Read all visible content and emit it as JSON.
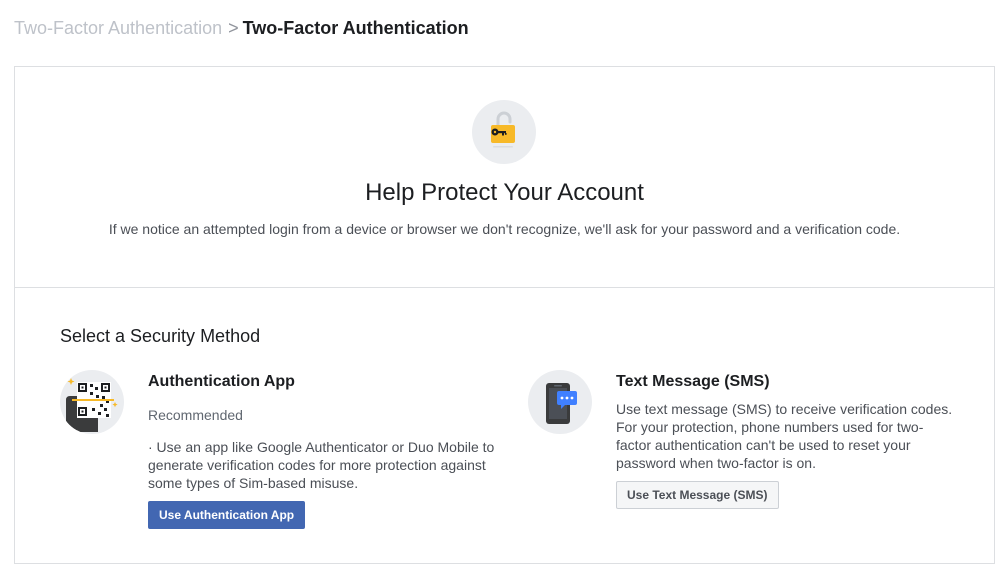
{
  "breadcrumb": {
    "parent": "Two-Factor Authentication",
    "separator": ">",
    "current": "Two-Factor Authentication"
  },
  "hero": {
    "icon": "unlocked-padlock-key-icon",
    "title": "Help Protect Your Account",
    "description": "If we notice an attempted login from a device or browser we don't recognize, we'll ask for your password and a verification code."
  },
  "section": {
    "title": "Select a Security Method"
  },
  "methods": {
    "app": {
      "icon": "qr-phone-icon",
      "name": "Authentication App",
      "badge": "Recommended",
      "description": "· Use an app like Google Authenticator or Duo Mobile to generate verification codes for more protection against some types of Sim-based misuse.",
      "button": "Use Authentication App"
    },
    "sms": {
      "icon": "phone-message-icon",
      "name": "Text Message (SMS)",
      "description": "Use text message (SMS) to receive verification codes. For your protection, phone numbers used for two-factor authentication can't be used to reset your password when two-factor is on.",
      "button": "Use Text Message (SMS)"
    }
  },
  "colors": {
    "primary_button": "#4267b2",
    "lock_yellow": "#f7b928",
    "message_blue": "#4080ff"
  }
}
